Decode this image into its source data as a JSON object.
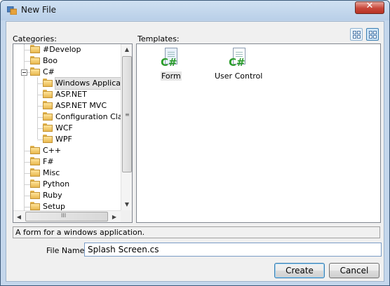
{
  "window": {
    "title": "New File"
  },
  "categories": {
    "label": "Categories:",
    "items": [
      {
        "label": "#Develop",
        "level": 1
      },
      {
        "label": "Boo",
        "level": 1
      },
      {
        "label": "C#",
        "level": 1,
        "expanded": true
      },
      {
        "label": "Windows Applicatio",
        "level": 2,
        "selected": true
      },
      {
        "label": "ASP.NET",
        "level": 2
      },
      {
        "label": "ASP.NET MVC",
        "level": 2
      },
      {
        "label": "Configuration Classe",
        "level": 2
      },
      {
        "label": "WCF",
        "level": 2
      },
      {
        "label": "WPF",
        "level": 2
      },
      {
        "label": "C++",
        "level": 1
      },
      {
        "label": "F#",
        "level": 1
      },
      {
        "label": "Misc",
        "level": 1
      },
      {
        "label": "Python",
        "level": 1
      },
      {
        "label": "Ruby",
        "level": 1
      },
      {
        "label": "Setup",
        "level": 1
      }
    ],
    "hscroll_grip": "III"
  },
  "templates": {
    "label": "Templates:",
    "items": [
      {
        "label": "Form",
        "badge": "C#",
        "selected": true
      },
      {
        "label": "User Control",
        "badge": "C#"
      }
    ]
  },
  "description": "A form for a windows application.",
  "file_name": {
    "label": "File Name",
    "value": "Splash Screen.cs"
  },
  "buttons": {
    "create": "Create",
    "cancel": "Cancel"
  },
  "icons": {
    "close": "close-icon",
    "expand": "collapse-minus-icon"
  }
}
